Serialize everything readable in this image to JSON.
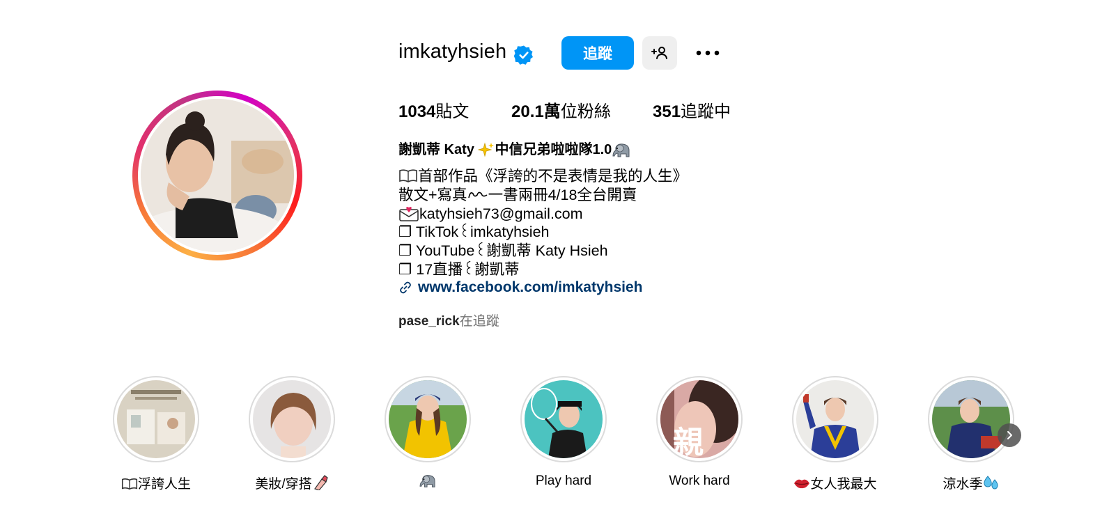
{
  "profile": {
    "username": "imkatyhsieh",
    "follow_label": "追蹤",
    "stats": {
      "posts_count": "1034",
      "posts_label": "貼文",
      "followers_count": "20.1萬",
      "followers_label": "位粉絲",
      "following_count": "351",
      "following_label": "追蹤中"
    },
    "full_name_part1": "謝凱蒂 Katy",
    "full_name_part2": "中信兄弟啦啦隊1.0",
    "bio_lines": [
      "首部作品《浮誇的不是表情是我的人生》",
      "散文+寫真",
      "一書兩冊4/18全台開賣",
      "katyhsieh73@gmail.com",
      "❐ TikTok꒰imkatyhsieh",
      "❐ YouTube꒰謝凱蒂 Katy Hsieh",
      "❐ 17直播꒰謝凱蒂"
    ],
    "link": "www.facebook.com/imkatyhsieh",
    "followed_by_name": "pase_rick",
    "followed_by_suffix": "在追蹤"
  },
  "highlights": [
    {
      "label": "浮誇人生",
      "icon": "open-book-icon"
    },
    {
      "label": "美妝/穿搭",
      "icon": "lipstick-icon"
    },
    {
      "label": "",
      "icon": "elephant-icon"
    },
    {
      "label": "Play hard",
      "icon": ""
    },
    {
      "label": "Work hard",
      "icon": ""
    },
    {
      "label": "女人我最大",
      "icon": "lips-icon"
    },
    {
      "label": "涼水季",
      "icon": "water-drops-icon"
    }
  ],
  "colors": {
    "follow_button": "#0095f6",
    "link": "#00376b",
    "verified_badge": "#0095f6",
    "secondary_text": "#737373"
  }
}
